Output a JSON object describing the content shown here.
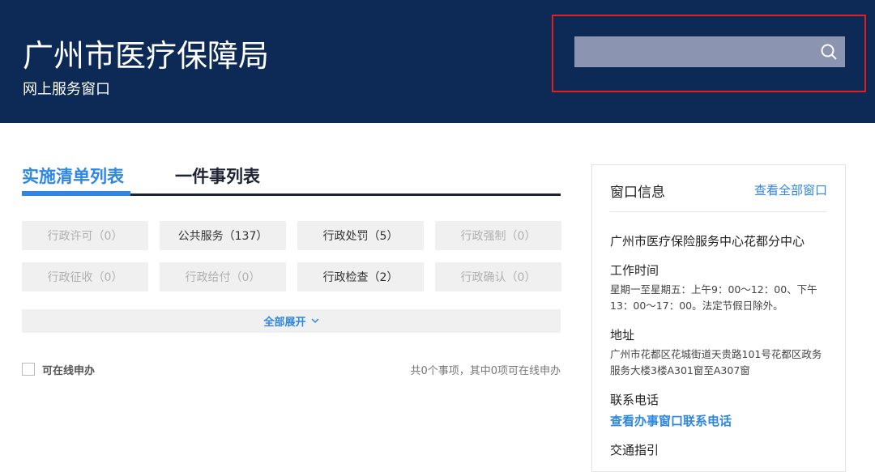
{
  "header": {
    "title": "广州市医疗保障局",
    "subtitle": "网上服务窗口",
    "search_placeholder": "",
    "search_icon": "search-icon"
  },
  "tabs": [
    {
      "label": "实施清单列表",
      "active": true
    },
    {
      "label": "一件事列表",
      "active": false
    }
  ],
  "categories": [
    {
      "label": "行政许可（0）",
      "enabled": false
    },
    {
      "label": "公共服务（137）",
      "enabled": true
    },
    {
      "label": "行政处罚（5）",
      "enabled": true
    },
    {
      "label": "行政强制（0）",
      "enabled": false
    },
    {
      "label": "行政征收（0）",
      "enabled": false
    },
    {
      "label": "行政给付（0）",
      "enabled": false
    },
    {
      "label": "行政检查（2）",
      "enabled": true
    },
    {
      "label": "行政确认（0）",
      "enabled": false
    }
  ],
  "expand_label": "全部展开",
  "online_checkbox_label": "可在线申办",
  "stats_text": "共0个事项，其中0项可在线申办",
  "panel": {
    "title": "窗口信息",
    "view_all": "查看全部窗口",
    "center": "广州市医疗保险服务中心花都分中心",
    "hours_label": "工作时间",
    "hours": "星期一至星期五：上午9：00～12：00、下午13：00～17：00。法定节假日除外。",
    "address_label": "地址",
    "address": "广州市花都区花城街道天贵路101号花都区政务服务大楼3楼A301窗至A307窗",
    "phone_label": "联系电话",
    "phone_link": "查看办事窗口联系电话",
    "traffic_label": "交通指引"
  },
  "colors": {
    "header_bg": "#0c2a55",
    "accent": "#2f87e0",
    "highlight_border": "#e02020"
  }
}
